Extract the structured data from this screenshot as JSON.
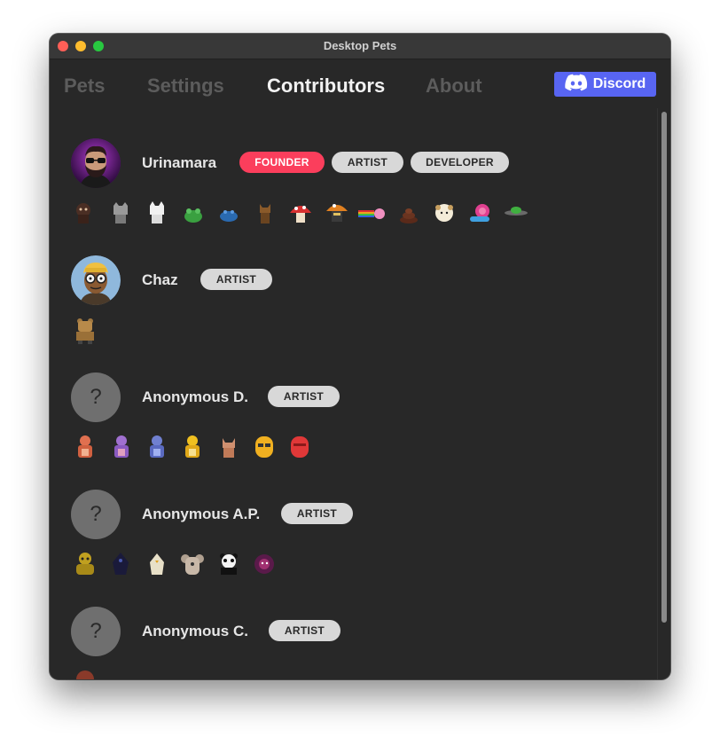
{
  "window": {
    "title": "Desktop Pets"
  },
  "tabs": [
    {
      "label": "Pets",
      "active": false
    },
    {
      "label": "Settings",
      "active": false
    },
    {
      "label": "Contributors",
      "active": true
    },
    {
      "label": "About",
      "active": false
    }
  ],
  "discord": {
    "label": "Discord",
    "icon": "discord-icon",
    "color": "#5865f2"
  },
  "colors": {
    "founder_badge": "#fb3e5c",
    "role_badge": "#d8d8d8",
    "background": "#282828"
  },
  "contributors": [
    {
      "name": "Urinamara",
      "avatar": "bearded-man-avatar",
      "badges": [
        "FOUNDER",
        "ARTIST",
        "DEVELOPER"
      ],
      "pets": [
        "monkey-pet-icon",
        "grey-cat-pet-icon",
        "white-cat-pet-icon",
        "green-frog-pet-icon",
        "blue-crab-pet-icon",
        "brown-dog-pet-icon",
        "red-mushroom-pet-icon",
        "wizard-mushroom-pet-icon",
        "rainbow-cat-pet-icon",
        "poop-pet-icon",
        "sheep-pet-icon",
        "snail-pet-icon",
        "ufo-pet-icon"
      ]
    },
    {
      "name": "Chaz",
      "avatar": "cartoon-man-avatar",
      "badges": [
        "ARTIST"
      ],
      "pets": [
        "bear-pet-icon"
      ]
    },
    {
      "name": "Anonymous D.",
      "avatar": "?",
      "badges": [
        "ARTIST"
      ],
      "pets": [
        "orange-dino-pet-icon",
        "purple-dino-pet-icon",
        "blue-dino-pet-icon",
        "yellow-dino-pet-icon",
        "fox-pet-icon",
        "yellow-blob-pet-icon",
        "red-blob-pet-icon"
      ]
    },
    {
      "name": "Anonymous A.P.",
      "avatar": "?",
      "badges": [
        "ARTIST"
      ],
      "pets": [
        "yellow-ape-pet-icon",
        "dark-bird-pet-icon",
        "white-bird-pet-icon",
        "koala-pet-icon",
        "panda-pet-icon",
        "hedgehog-pet-icon"
      ]
    },
    {
      "name": "Anonymous C.",
      "avatar": "?",
      "badges": [
        "ARTIST"
      ],
      "pets": [
        "red-pet-icon"
      ]
    }
  ]
}
